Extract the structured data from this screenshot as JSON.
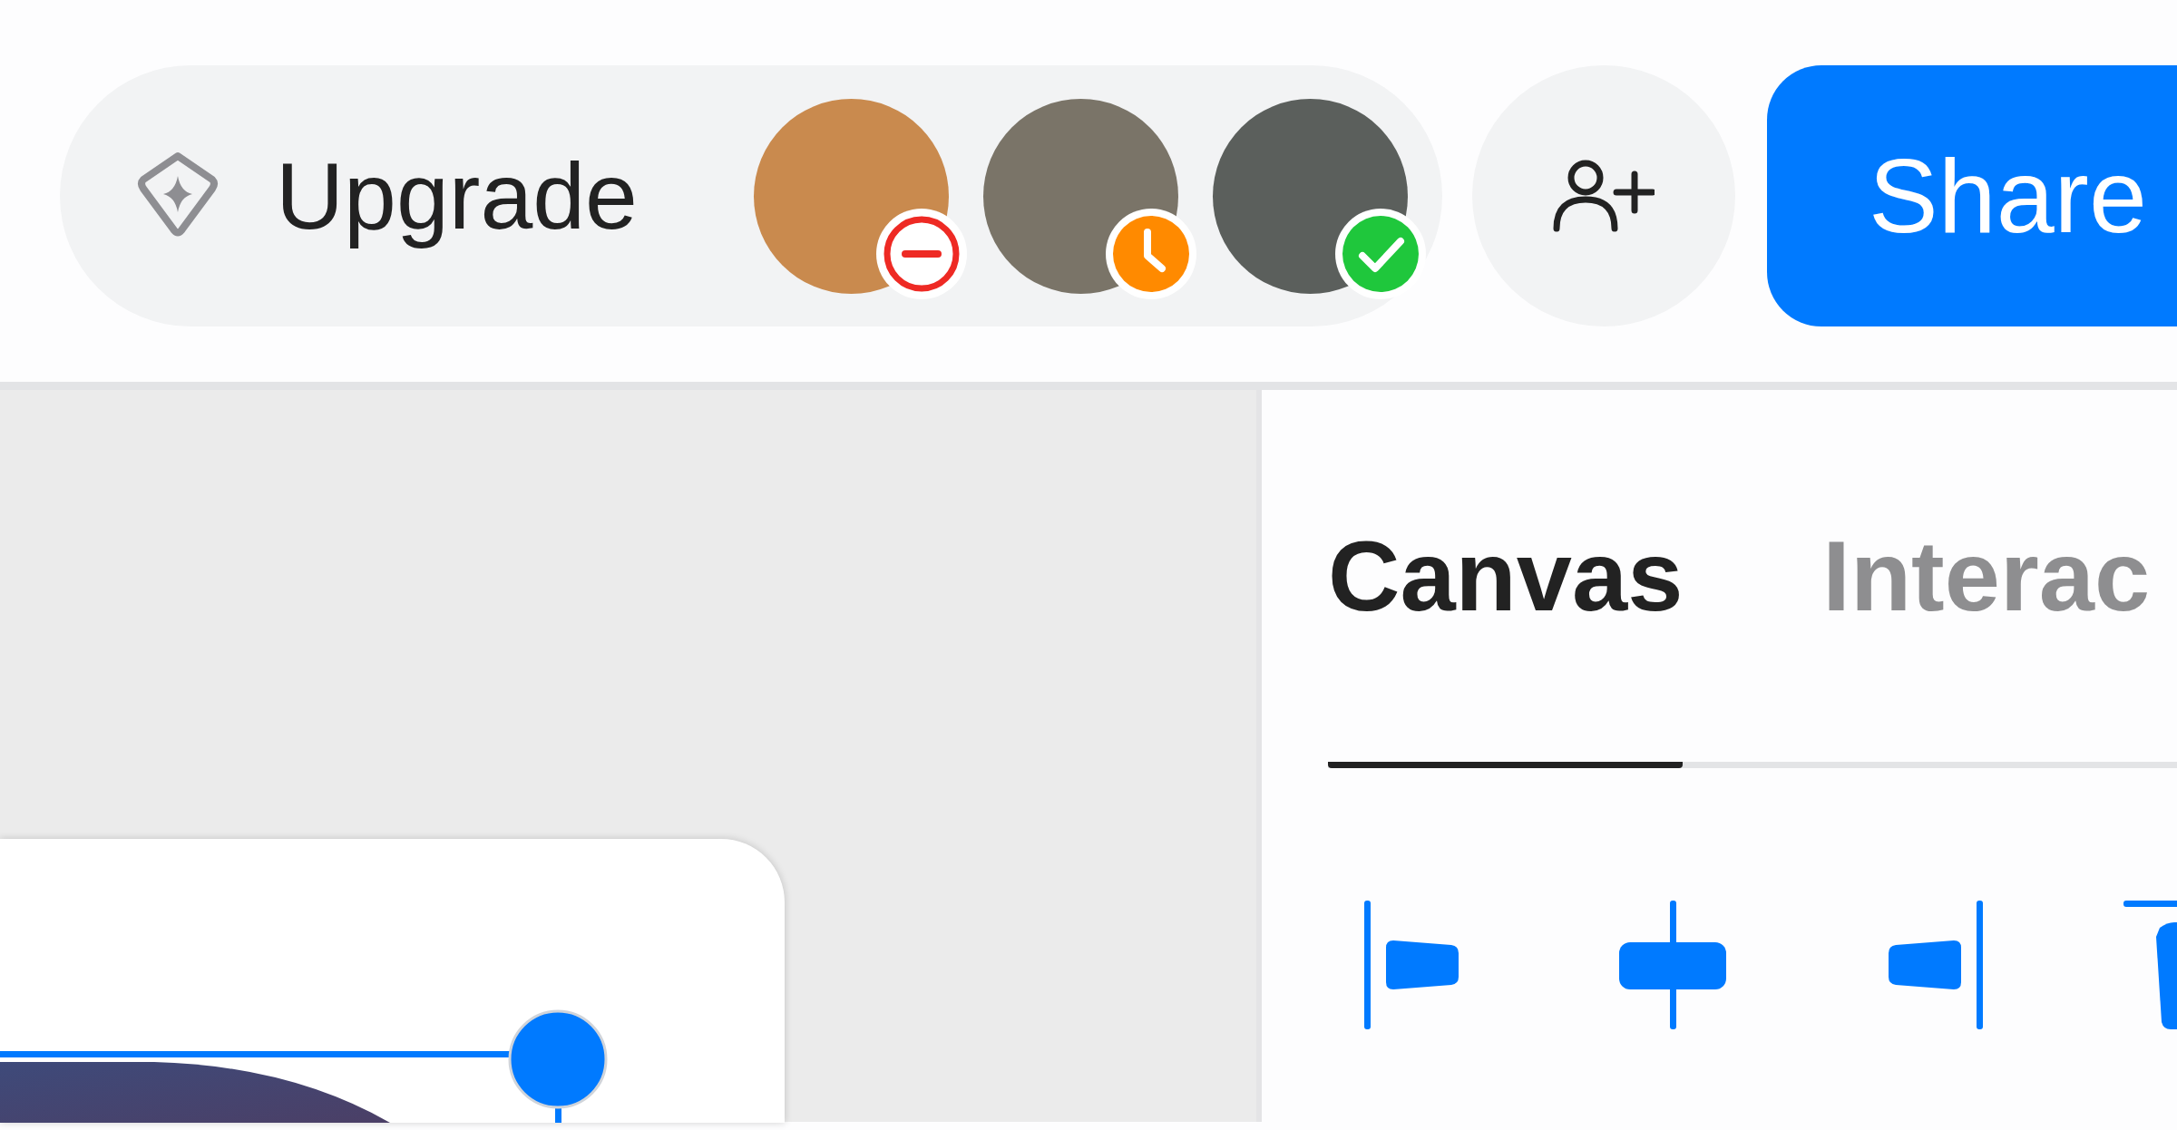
{
  "upgrade": {
    "label": "Upgrade"
  },
  "avatars": [
    {
      "kind": "busy",
      "color": "#ee2a24"
    },
    {
      "kind": "away",
      "color": "#ff8a00"
    },
    {
      "kind": "available",
      "color": "#1fc73c"
    }
  ],
  "share_button": {
    "label": "Share"
  },
  "inspector": {
    "tabs": [
      {
        "label": "Canvas",
        "selected": true
      },
      {
        "label": "Interac",
        "selected": false
      }
    ]
  }
}
